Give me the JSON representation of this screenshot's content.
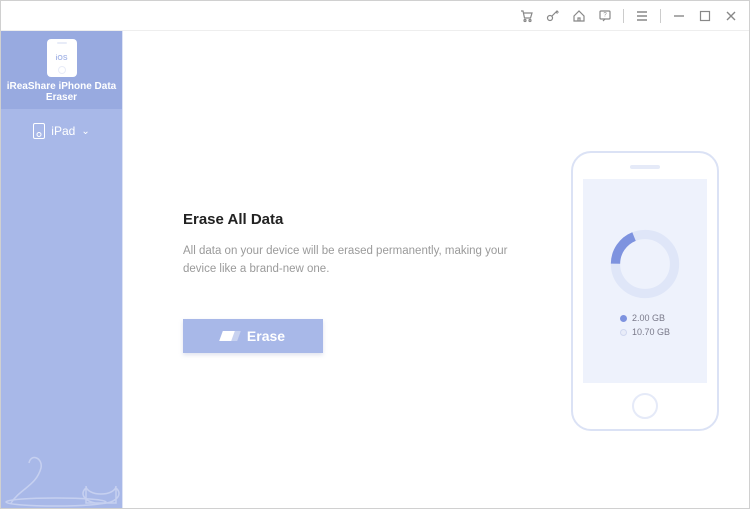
{
  "brand": "iReaShare iPhone Data Eraser",
  "ios_badge": "iOS",
  "device": {
    "name": "iPad"
  },
  "titlebar_icons": {
    "cart": "cart-icon",
    "key": "key-icon",
    "home": "home-icon",
    "feedback": "feedback-icon",
    "menu": "menu-icon",
    "minimize": "minimize-icon",
    "maximize": "maximize-icon",
    "close": "close-icon"
  },
  "main": {
    "heading": "Erase All Data",
    "description": "All data on your device will be erased permanently, making your device like a brand-new one.",
    "erase_label": "Erase"
  },
  "storage": {
    "used_label": "2.00 GB",
    "total_label": "10.70 GB",
    "used_gb": 2.0,
    "total_gb": 10.7
  },
  "colors": {
    "accent": "#a8b8e8",
    "accent_dark": "#7e93df",
    "ring_bg": "#dfe6f8",
    "used_swatch": "#7e93df",
    "total_swatch": "#e8ecf8"
  }
}
